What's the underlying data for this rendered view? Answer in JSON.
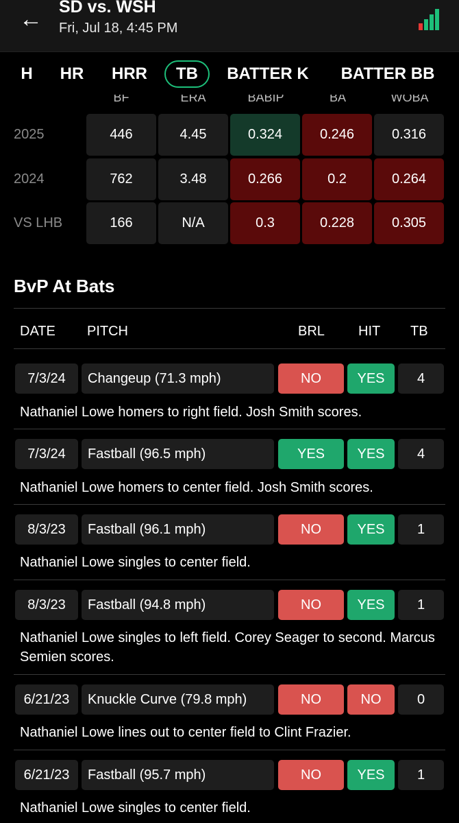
{
  "header": {
    "title": "SD vs. WSH",
    "subtitle": "Fri, Jul 18, 4:45 PM",
    "back_icon": "←",
    "signal_colors": [
      "#e53935",
      "#1dbf7a",
      "#1dbf7a",
      "#1dbf7a"
    ]
  },
  "tabs": [
    {
      "label": "H",
      "active": false
    },
    {
      "label": "HR",
      "active": false
    },
    {
      "label": "HRR",
      "active": false
    },
    {
      "label": "TB",
      "active": true
    },
    {
      "label": "BATTER K",
      "active": false
    },
    {
      "label": "BATTER BB",
      "active": false
    }
  ],
  "stats": {
    "columns": [
      "BF",
      "ERA",
      "BABIP",
      "BA",
      "WOBA"
    ],
    "rows": [
      {
        "label": "2025",
        "values": [
          "446",
          "4.45",
          "0.324",
          "0.246",
          "0.316"
        ],
        "tones": [
          "neutral",
          "neutral",
          "green",
          "red",
          "neutral"
        ]
      },
      {
        "label": "2024",
        "values": [
          "762",
          "3.48",
          "0.266",
          "0.2",
          "0.264"
        ],
        "tones": [
          "neutral",
          "neutral",
          "red",
          "red",
          "red"
        ]
      },
      {
        "label": "VS LHB",
        "values": [
          "166",
          "N/A",
          "0.3",
          "0.228",
          "0.305"
        ],
        "tones": [
          "neutral",
          "neutral",
          "red",
          "red",
          "red"
        ]
      }
    ]
  },
  "bvp": {
    "title": "BvP At Bats",
    "headers": {
      "date": "DATE",
      "pitch": "PITCH",
      "brl": "BRL",
      "hit": "HIT",
      "tb": "TB"
    },
    "at_bats": [
      {
        "date": "7/3/24",
        "pitch": "Changeup (71.3 mph)",
        "brl": "NO",
        "hit": "YES",
        "tb": "4",
        "desc": "Nathaniel Lowe homers to right field. Josh Smith scores."
      },
      {
        "date": "7/3/24",
        "pitch": "Fastball (96.5 mph)",
        "brl": "YES",
        "hit": "YES",
        "tb": "4",
        "desc": "Nathaniel Lowe homers to center field. Josh Smith scores."
      },
      {
        "date": "8/3/23",
        "pitch": "Fastball (96.1 mph)",
        "brl": "NO",
        "hit": "YES",
        "tb": "1",
        "desc": "Nathaniel Lowe singles to center field."
      },
      {
        "date": "8/3/23",
        "pitch": "Fastball (94.8 mph)",
        "brl": "NO",
        "hit": "YES",
        "tb": "1",
        "desc": "Nathaniel Lowe singles to left field. Corey Seager to second. Marcus Semien scores."
      },
      {
        "date": "6/21/23",
        "pitch": "Knuckle Curve (79.8 mph)",
        "brl": "NO",
        "hit": "NO",
        "tb": "0",
        "desc": "Nathaniel Lowe lines out to center field to Clint Frazier."
      },
      {
        "date": "6/21/23",
        "pitch": "Fastball (95.7 mph)",
        "brl": "NO",
        "hit": "YES",
        "tb": "1",
        "desc": "Nathaniel Lowe singles to center field."
      }
    ]
  },
  "colors": {
    "yes": "#1fa76c",
    "no": "#d9534f",
    "red_cell": "#5a0a0a",
    "green_cell": "#143a2a",
    "neutral_cell": "#1c1c1c"
  }
}
